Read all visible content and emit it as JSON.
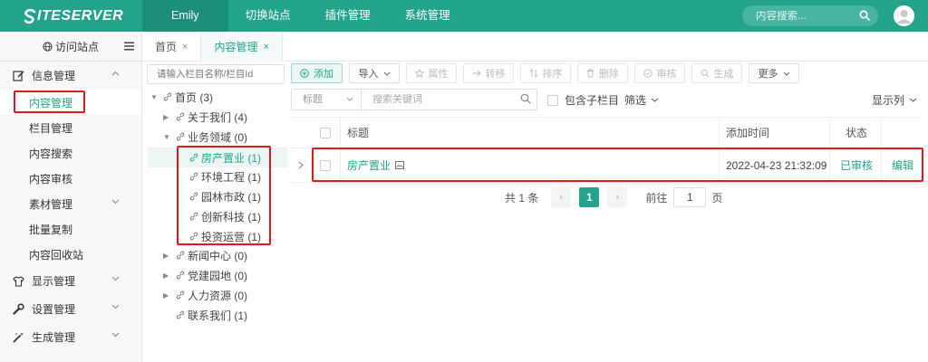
{
  "brand": {
    "logo_text": "ITESERVER"
  },
  "topnav": {
    "user": "Emily",
    "items": [
      "切换站点",
      "插件管理",
      "系统管理"
    ],
    "search_placeholder": "内容搜索..."
  },
  "sidebar": {
    "visit_site": "访问站点",
    "groups": [
      {
        "label": "信息管理",
        "icon": "edit-icon",
        "expanded": true
      },
      {
        "label": "显示管理",
        "icon": "shirt-icon",
        "expanded": false
      },
      {
        "label": "设置管理",
        "icon": "wrench-icon",
        "expanded": false
      },
      {
        "label": "生成管理",
        "icon": "magic-wand-icon",
        "expanded": false
      }
    ],
    "sub_items": [
      "内容管理",
      "栏目管理",
      "内容搜索",
      "内容审核",
      "素材管理",
      "批量复制",
      "内容回收站"
    ],
    "active_sub": "内容管理"
  },
  "tabs": [
    {
      "label": "首页",
      "close": "×"
    },
    {
      "label": "内容管理",
      "close": "×",
      "active": true
    }
  ],
  "tree": {
    "search_placeholder": "请输入栏目名称/栏目Id",
    "nodes": [
      "首页 (3)",
      "关于我们 (4)",
      "业务领域 (0)",
      "房产置业 (1)",
      "环境工程 (1)",
      "园林市政 (1)",
      "创新科技 (1)",
      "投资运营 (1)",
      "新闻中心 (0)",
      "党建园地 (0)",
      "人力资源 (0)",
      "联系我们 (1)"
    ],
    "selected": "房产置业 (1)"
  },
  "toolbar": {
    "add": "添加",
    "import": "导入",
    "attributes": "属性",
    "transfer": "转移",
    "sort": "排序",
    "delete": "删除",
    "audit": "审核",
    "generate": "生成",
    "more": "更多"
  },
  "filter": {
    "field": "标题",
    "keyword_placeholder": "搜索关键词",
    "include_children": "包含子栏目",
    "filter": "筛选",
    "display_columns": "显示列"
  },
  "table": {
    "columns": [
      "标题",
      "添加时间",
      "状态"
    ],
    "rows": [
      {
        "title": "房产置业",
        "added": "2022-04-23 21:32:09",
        "status": "已审核",
        "action": "编辑"
      }
    ]
  },
  "pagination": {
    "total": "共 1 条",
    "current": "1",
    "goto_label": "前往",
    "goto_value": "1",
    "page_suffix": "页"
  },
  "colors": {
    "accent": "#22a38a",
    "highlight": "#e31818"
  }
}
